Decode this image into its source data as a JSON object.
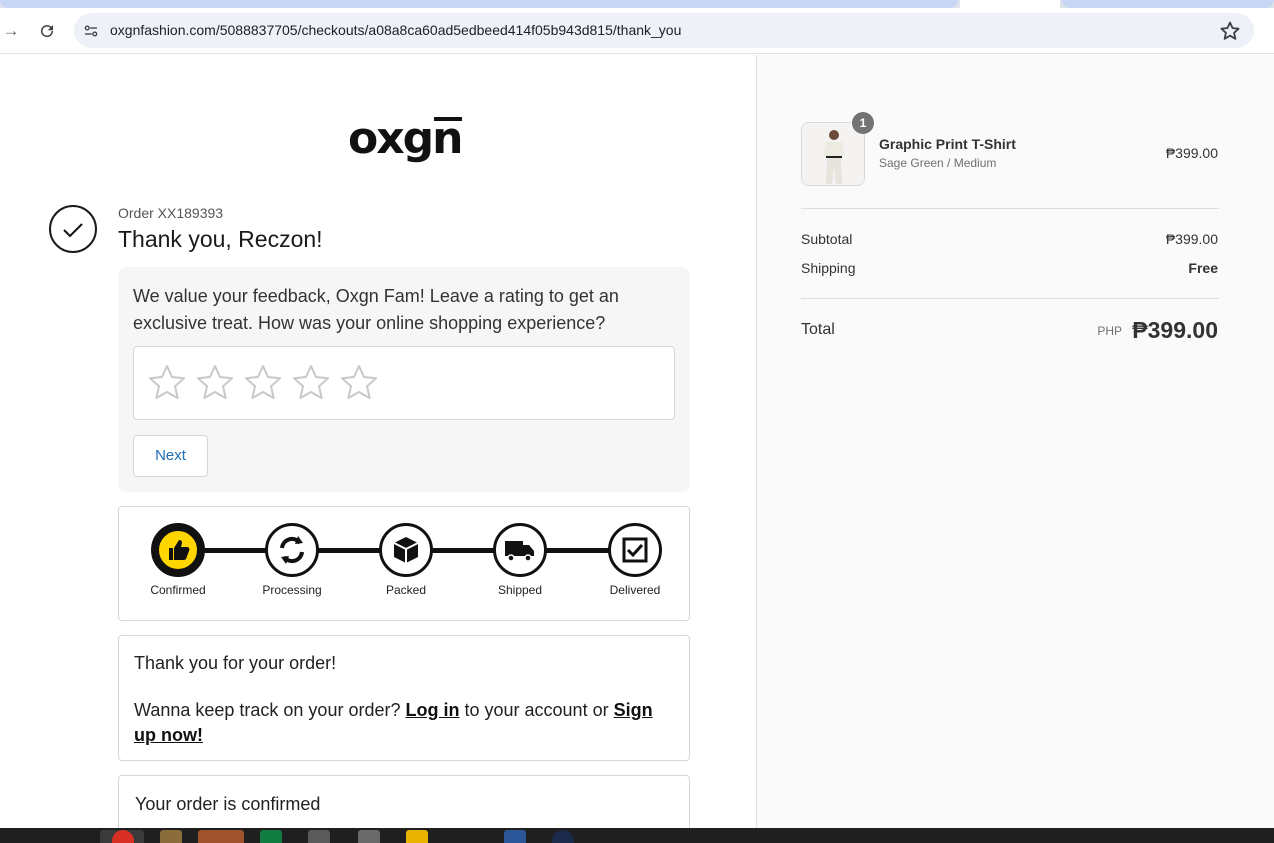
{
  "browser": {
    "url": "oxgnfashion.com/5088837705/checkouts/a08a8ca60ad5edbeed414f05b943d815/thank_you"
  },
  "header": {
    "logo_text": "oxgn"
  },
  "order": {
    "number": "Order XX189393",
    "thanks": "Thank you, Reczon!"
  },
  "feedback": {
    "prompt": "We value your feedback, Oxgn Fam! Leave a rating to get an exclusive treat. How was your online shopping experience?",
    "rating": 0,
    "max_rating": 5,
    "next_label": "Next"
  },
  "tracker": {
    "steps": [
      {
        "label": "Confirmed",
        "icon": "thumbs-up-icon",
        "active": true
      },
      {
        "label": "Processing",
        "icon": "refresh-icon",
        "active": false
      },
      {
        "label": "Packed",
        "icon": "box-icon",
        "active": false
      },
      {
        "label": "Shipped",
        "icon": "truck-icon",
        "active": false
      },
      {
        "label": "Delivered",
        "icon": "checkbox-icon",
        "active": false
      }
    ],
    "active_color": "#ffd600"
  },
  "thanks_box": {
    "line1": "Thank you for your order!",
    "prefix": "Wanna keep track on your order?",
    "login_label": "Log in",
    "middle": "to your account or",
    "signup_label": "Sign up now!"
  },
  "confirm_box": {
    "title": "Your order is confirmed"
  },
  "summary": {
    "item": {
      "name": "Graphic Print T-Shirt",
      "variant": "Sage Green / Medium",
      "price": "₱399.00",
      "quantity": "1"
    },
    "subtotal_label": "Subtotal",
    "subtotal_value": "₱399.00",
    "shipping_label": "Shipping",
    "shipping_value": "Free",
    "total_label": "Total",
    "currency": "PHP",
    "total_value": "₱399.00"
  }
}
